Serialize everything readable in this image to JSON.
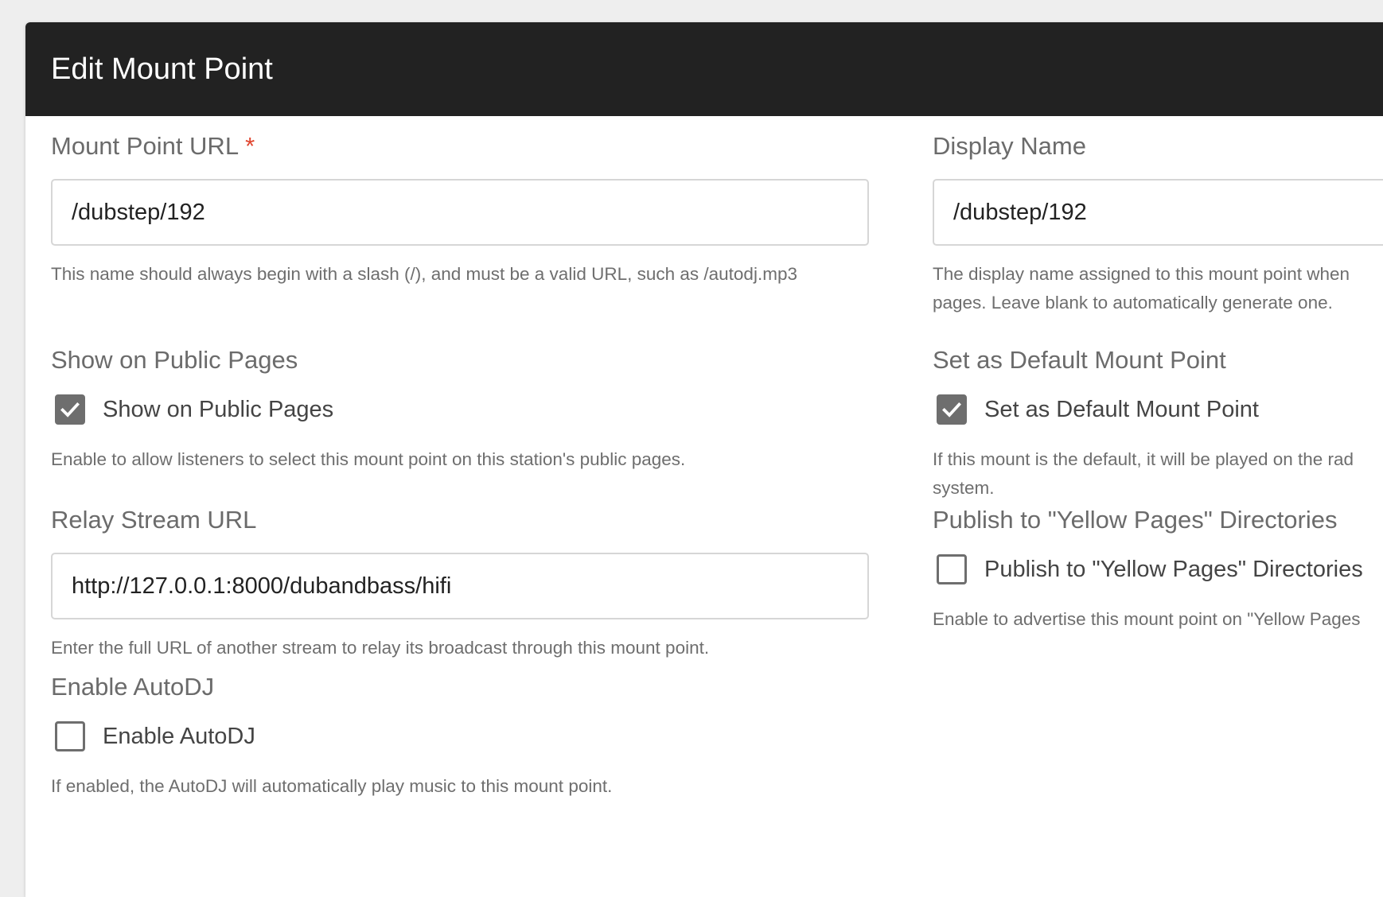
{
  "modal": {
    "title": "Edit Mount Point"
  },
  "form": {
    "mount_url": {
      "label": "Mount Point URL",
      "required_mark": "*",
      "value": "/dubstep/192",
      "help": "This name should always begin with a slash (/), and must be a valid URL, such as /autodj.mp3"
    },
    "display_name": {
      "label": "Display Name",
      "value": "/dubstep/192",
      "help_line1": "The display name assigned to this mount point when",
      "help_line2": "pages. Leave blank to automatically generate one."
    },
    "show_public": {
      "label": "Show on Public Pages",
      "checkbox_label": "Show on Public Pages",
      "checked": true,
      "help": "Enable to allow listeners to select this mount point on this station's public pages."
    },
    "default_mount": {
      "label": "Set as Default Mount Point",
      "checkbox_label": "Set as Default Mount Point",
      "checked": true,
      "help_line1": "If this mount is the default, it will be played on the rad",
      "help_line2": "system."
    },
    "relay_url": {
      "label": "Relay Stream URL",
      "value": "http://127.0.0.1:8000/dubandbass/hifi",
      "help": "Enter the full URL of another stream to relay its broadcast through this mount point."
    },
    "yellow_pages": {
      "label": "Publish to \"Yellow Pages\" Directories",
      "checkbox_label": "Publish to \"Yellow Pages\" Directories",
      "checked": false,
      "help": "Enable to advertise this mount point on \"Yellow Pages"
    },
    "autodj": {
      "label": "Enable AutoDJ",
      "checkbox_label": "Enable AutoDJ",
      "checked": false,
      "help": "If enabled, the AutoDJ will automatically play music to this mount point."
    }
  },
  "colors": {
    "header_bg": "#222222",
    "checkbox_checked": "#6e6e6e",
    "required": "#e0452f"
  },
  "icons": {
    "checkmark": "check-icon"
  }
}
